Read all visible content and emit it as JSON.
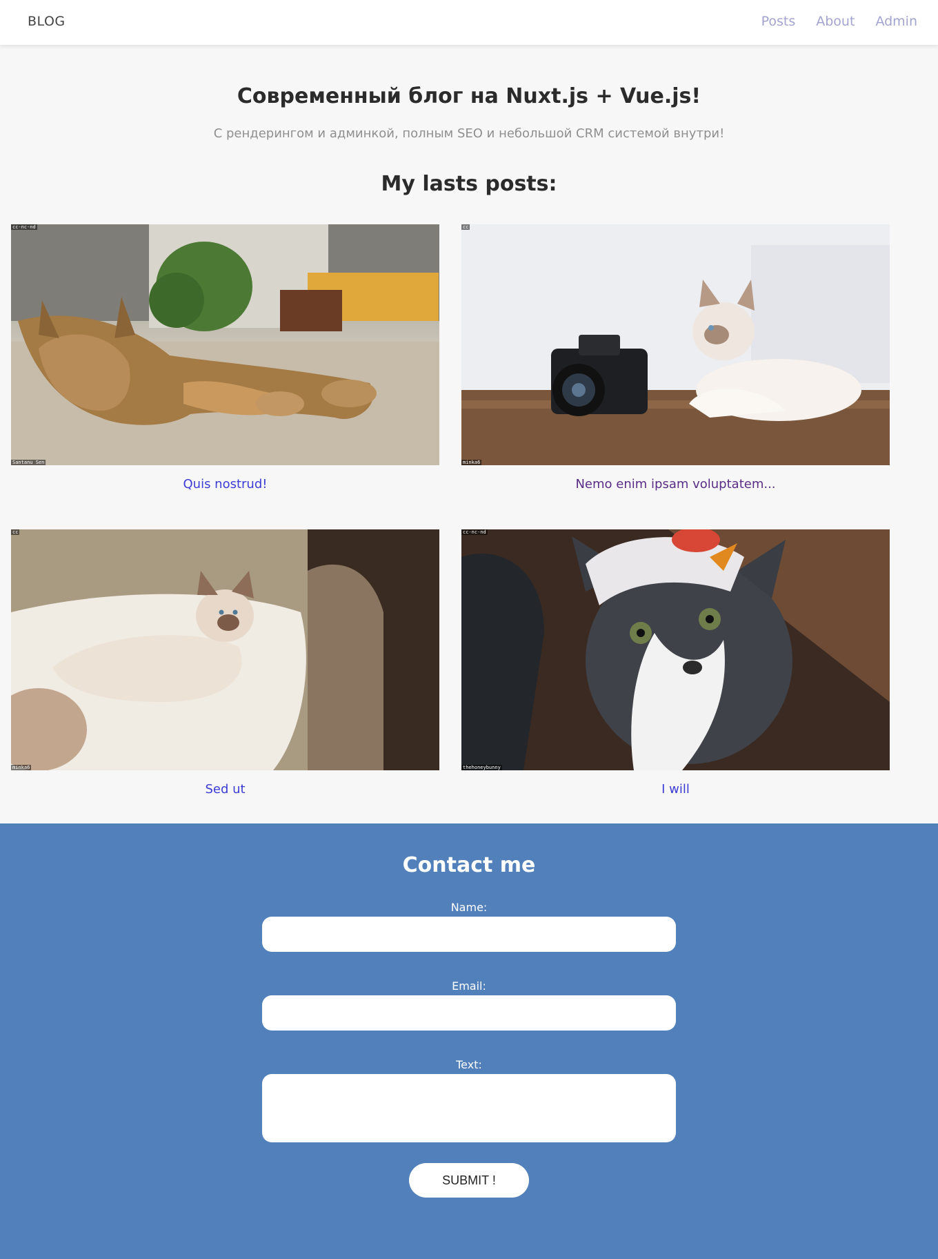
{
  "nav": {
    "brand": "BLOG",
    "links": [
      "Posts",
      "About",
      "Admin"
    ]
  },
  "hero": {
    "title": "Современный блог на Nuxt.js + Vue.js!",
    "subtitle": "С рендерингом и админкой, полным SEO и небольшой CRM системой внутри!"
  },
  "posts_section": {
    "title": "My lasts posts:",
    "posts": [
      {
        "title": "Quis nostrud!",
        "credit_top": "cc-nc-nd",
        "credit_bottom": "Santanu Sen"
      },
      {
        "title": "Nemo enim ipsam voluptatem...",
        "credit_top": "cc",
        "credit_bottom": "minka6"
      },
      {
        "title": "Sed ut",
        "credit_top": "cc",
        "credit_bottom": "minka6"
      },
      {
        "title": "I will",
        "credit_top": "cc-nc-nd",
        "credit_bottom": "thehoneybunny"
      }
    ]
  },
  "contact": {
    "title": "Contact me",
    "name_label": "Name:",
    "email_label": "Email:",
    "text_label": "Text:",
    "name_value": "",
    "email_value": "",
    "text_value": "",
    "submit_label": "SUBMIT !"
  },
  "colors": {
    "background": "#f7f7f7",
    "nav_link": "#a3a3cf",
    "post_link": "#3b3bd6",
    "post_link_visited": "#5a2d86",
    "contact_bg": "#5180bb"
  }
}
